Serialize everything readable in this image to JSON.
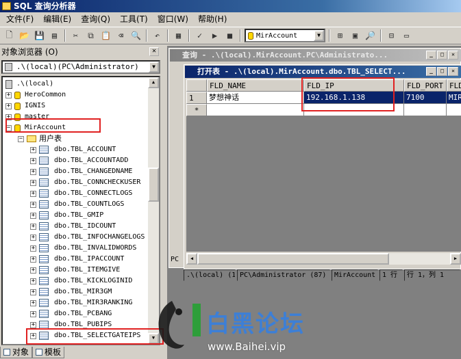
{
  "window": {
    "title": "SQL 查询分析器"
  },
  "menu": [
    "文件(F)",
    "编辑(E)",
    "查询(Q)",
    "工具(T)",
    "窗口(W)",
    "帮助(H)"
  ],
  "toolbar": {
    "database": "MirAccount"
  },
  "object_browser": {
    "title": "对象浏览器 (O)",
    "server": ".\\(local)(PC\\Administrator)",
    "root": ".\\(local)",
    "databases": [
      "HeroCommon",
      "IGNIS",
      "master",
      "MirAccount"
    ],
    "user_tables_folder": "用户表",
    "tables": [
      "dbo.TBL_ACCOUNT",
      "dbo.TBL_ACCOUNTADD",
      "dbo.TBL_CHANGEDNAME",
      "dbo.TBL_CONNCHECKUSER",
      "dbo.TBL_CONNECTLOGS",
      "dbo.TBL_COUNTLOGS",
      "dbo.TBL_GMIP",
      "dbo.TBL_IDCOUNT",
      "dbo.TBL_INFOCHANGELOGS",
      "dbo.TBL_INVALIDWORDS",
      "dbo.TBL_IPACCOUNT",
      "dbo.TBL_ITEMGIVE",
      "dbo.TBL_KICKLOGINID",
      "dbo.TBL_MIR3GM",
      "dbo.TBL_MIR3RANKING",
      "dbo.TBL_PCBANG",
      "dbo.TBL_PUBIPS",
      "dbo.TBL_SELECTGATEIPS"
    ],
    "tabs": [
      "对象",
      "模板"
    ]
  },
  "query_window": {
    "title": "查询 - .\\(local).MirAccount.PC\\Administrato..."
  },
  "open_table_window": {
    "title": "打开表 - .\\(local).MirAccount.dbo.TBL_SELECT...",
    "columns": [
      "FLD_NAME",
      "FLD_IP",
      "FLD_PORT",
      "FLD"
    ],
    "rows": [
      {
        "num": "1",
        "cells": [
          "梦想神话",
          "192.168.1.138",
          "7100",
          "MIR"
        ]
      }
    ],
    "new_row_marker": "*"
  },
  "query_side_label": "PC",
  "status_bar": [
    ".\\(local) (1",
    "PC\\Administrator (87)",
    "MirAccount",
    "1 行",
    "行 1，列 1"
  ],
  "watermark": {
    "text": "白黑论坛",
    "url": "www.Baihei.vip"
  }
}
